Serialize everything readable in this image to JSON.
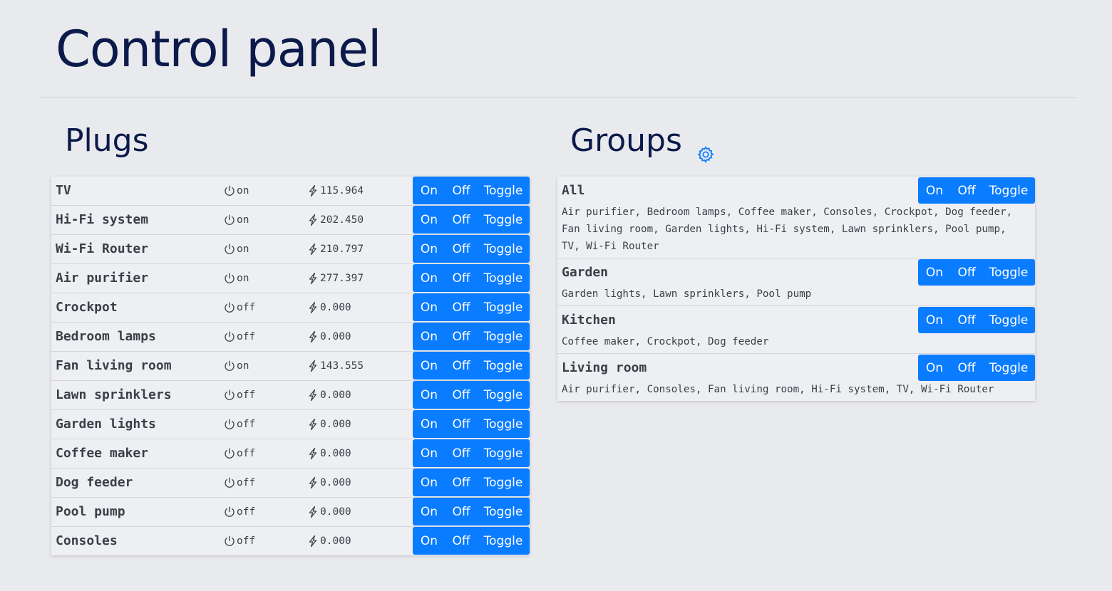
{
  "page": {
    "title": "Control panel"
  },
  "plugs": {
    "title": "Plugs",
    "items": [
      {
        "name": "TV",
        "state": "on",
        "power": "115.964"
      },
      {
        "name": "Hi-Fi system",
        "state": "on",
        "power": "202.450"
      },
      {
        "name": "Wi-Fi Router",
        "state": "on",
        "power": "210.797"
      },
      {
        "name": "Air purifier",
        "state": "on",
        "power": "277.397"
      },
      {
        "name": "Crockpot",
        "state": "off",
        "power": "0.000"
      },
      {
        "name": "Bedroom lamps",
        "state": "off",
        "power": "0.000"
      },
      {
        "name": "Fan living room",
        "state": "on",
        "power": "143.555"
      },
      {
        "name": "Lawn sprinklers",
        "state": "off",
        "power": "0.000"
      },
      {
        "name": "Garden lights",
        "state": "off",
        "power": "0.000"
      },
      {
        "name": "Coffee maker",
        "state": "off",
        "power": "0.000"
      },
      {
        "name": "Dog feeder",
        "state": "off",
        "power": "0.000"
      },
      {
        "name": "Pool pump",
        "state": "off",
        "power": "0.000"
      },
      {
        "name": "Consoles",
        "state": "off",
        "power": "0.000"
      }
    ]
  },
  "groups": {
    "title": "Groups",
    "settings_icon": "gear-icon",
    "items": [
      {
        "name": "All",
        "members": "Air purifier, Bedroom lamps, Coffee maker, Consoles, Crockpot, Dog feeder,\nFan living room, Garden lights, Hi-Fi system, Lawn sprinklers, Pool pump,\nTV, Wi-Fi Router"
      },
      {
        "name": "Garden",
        "members": "Garden lights, Lawn sprinklers, Pool pump"
      },
      {
        "name": "Kitchen",
        "members": "Coffee maker, Crockpot, Dog feeder"
      },
      {
        "name": "Living room",
        "members": "Air purifier, Consoles, Fan living room, Hi-Fi system, TV, Wi-Fi Router"
      }
    ]
  },
  "buttons": {
    "on": "On",
    "off": "Off",
    "toggle": "Toggle"
  },
  "colors": {
    "accent": "#0a7cff",
    "background": "#e9eaee",
    "title": "#0b1a4a"
  }
}
